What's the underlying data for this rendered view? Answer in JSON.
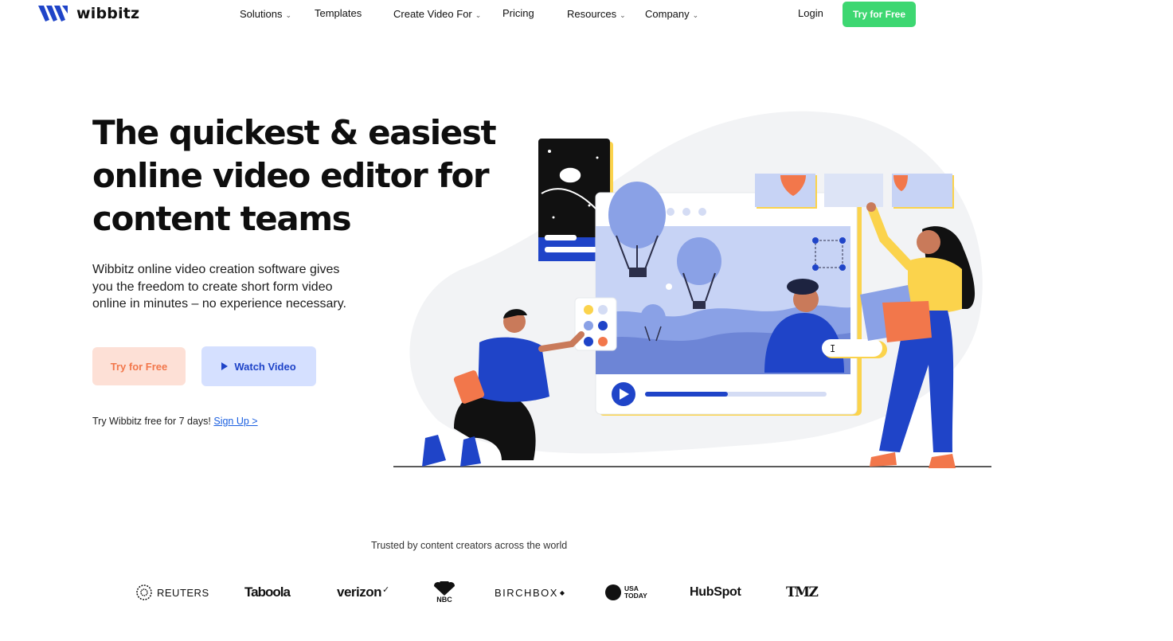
{
  "brand": {
    "name": "wibbitz",
    "primary_color": "#3dd771",
    "accent_blue": "#1f44c8",
    "logo_icon": "wibbitz-logo-icon"
  },
  "nav": {
    "items": [
      {
        "label": "Solutions",
        "dropdown": true
      },
      {
        "label": "Templates",
        "dropdown": false
      },
      {
        "label": "Create Video For",
        "dropdown": true
      },
      {
        "label": "Pricing",
        "dropdown": false
      },
      {
        "label": "Resources",
        "dropdown": true
      },
      {
        "label": "Company",
        "dropdown": true
      }
    ],
    "login": "Login",
    "cta": "Try for Free"
  },
  "hero": {
    "title_lines": [
      "The quickest & easiest",
      "online video editor for",
      "content teams"
    ],
    "subtitle": "Wibbitz online video creation software gives you the freedom to create short form video online in minutes – no experience necessary.",
    "try_button": "Try for Free",
    "watch_button": "Watch Video",
    "trial_text": "Try Wibbitz free for 7 days! ",
    "trial_link": "Sign Up >"
  },
  "trusted": {
    "heading": "Trusted by content creators across the world",
    "logos": [
      "REUTERS",
      "Taboola",
      "verizon",
      "NBC",
      "BIRCHBOX",
      "USA TODAY",
      "HubSpot",
      "TMZ"
    ]
  },
  "illustration": {
    "text_cursor": "I"
  },
  "icons": [
    "wibbitz-logo-icon",
    "chevron-down-icon",
    "play-icon"
  ]
}
